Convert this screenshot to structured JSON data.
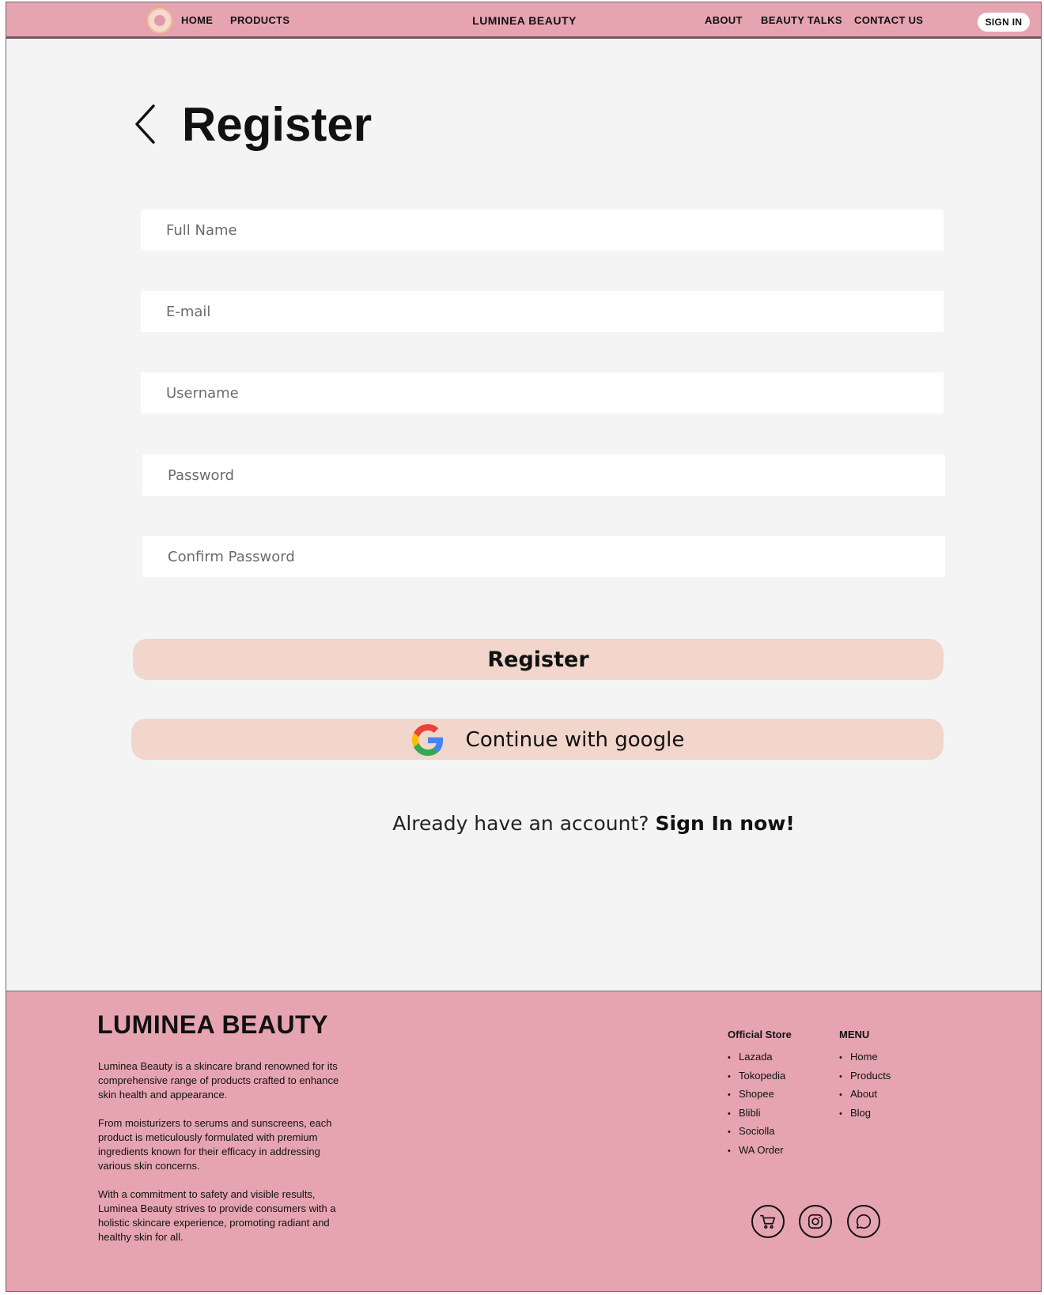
{
  "header": {
    "nav_left": [
      "HOME",
      "PRODUCTS"
    ],
    "brand": "LUMINEA BEAUTY",
    "nav_right": [
      "ABOUT",
      "BEAUTY TALKS",
      "CONTACT US"
    ],
    "signin_label": "SIGN IN"
  },
  "page": {
    "title": "Register"
  },
  "form": {
    "full_name_placeholder": "Full Name",
    "email_placeholder": "E-mail",
    "username_placeholder": "Username",
    "password_placeholder": "Password",
    "confirm_password_placeholder": "Confirm Password",
    "register_label": "Register",
    "google_label": "Continue with google",
    "signin_prompt": "Already have an account?",
    "signin_link": "Sign In now!"
  },
  "footer": {
    "brand": "LUMINEA BEAUTY",
    "desc": [
      "Luminea Beauty is a skincare brand renowned for its comprehensive range of products crafted to enhance skin health and appearance.",
      "From moisturizers to serums and sunscreens, each product is meticulously formulated with premium ingredients known for their efficacy in addressing various skin concerns.",
      "With a commitment to safety and visible results, Luminea Beauty strives to provide consumers with a holistic skincare experience, promoting radiant and healthy skin for all."
    ],
    "store_heading": "Official Store",
    "stores": [
      "Lazada",
      "Tokopedia",
      "Shopee",
      "Blibli",
      "Sociolla",
      "WA Order"
    ],
    "menu_heading": "MENU",
    "menu": [
      "Home",
      "Products",
      "About",
      "Blog"
    ],
    "social_icons": [
      "shopping-cart-icon",
      "instagram-icon",
      "whatsapp-icon"
    ]
  },
  "colors": {
    "header_bg": "#e6a4b1",
    "button_bg": "#f2d5cb",
    "page_bg": "#f4f4f4"
  }
}
